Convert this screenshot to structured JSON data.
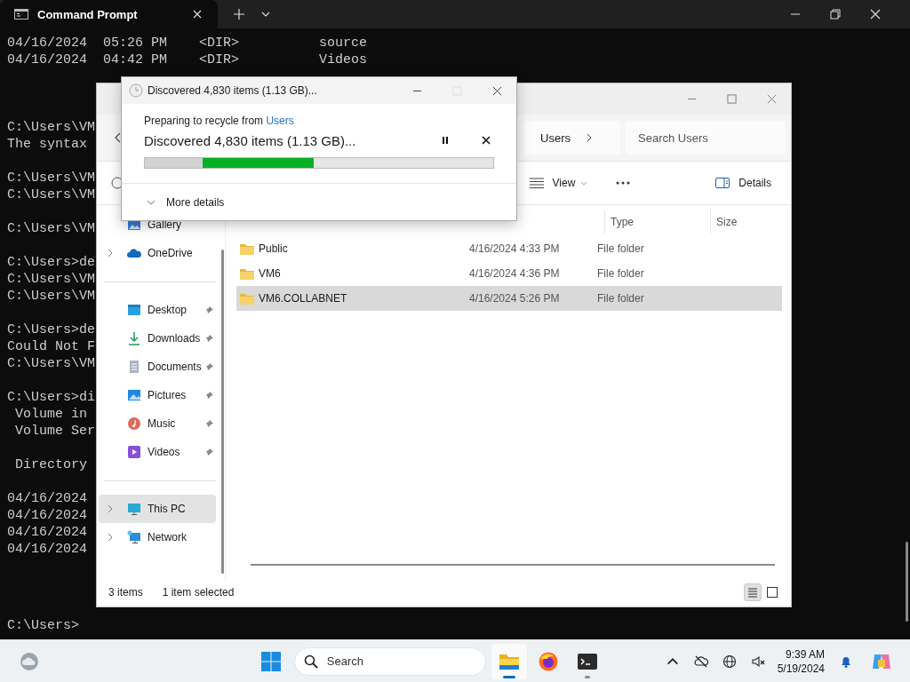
{
  "terminal": {
    "tab": {
      "title": "Command Prompt",
      "selected": true
    },
    "blocks": [
      [
        "04/16/2024  05:26 PM    <DIR>          source",
        "04/16/2024  04:42 PM    <DIR>          Videos"
      ],
      [
        "C:\\Users\\VM",
        "The syntax"
      ],
      [
        "C:\\Users\\VM",
        "C:\\Users\\VM"
      ],
      [
        "C:\\Users\\VM"
      ],
      [
        "C:\\Users>de",
        "C:\\Users\\VM",
        "C:\\Users\\VM"
      ],
      [
        "C:\\Users>de",
        "Could Not F",
        "C:\\Users\\VM"
      ],
      [
        "C:\\Users>di",
        " Volume in",
        " Volume Ser"
      ],
      [
        " Directory"
      ],
      [
        "04/16/2024",
        "04/16/2024",
        "04/16/2024",
        "04/16/2024"
      ],
      [
        "C:\\Users>"
      ]
    ]
  },
  "explorer": {
    "address": {
      "crumb": "Users"
    },
    "search": {
      "placeholder": "Search Users"
    },
    "command_bar": {
      "view": "View",
      "details": "Details"
    },
    "nav": [
      [
        {
          "label": "Gallery",
          "kind": "gallery",
          "selected": false
        },
        {
          "label": "OneDrive",
          "kind": "onedrive",
          "expanded": false,
          "selected": false
        }
      ],
      [
        {
          "label": "Desktop",
          "kind": "desktop",
          "pinned": true,
          "selected": false
        },
        {
          "label": "Downloads",
          "kind": "downloads",
          "pinned": true,
          "selected": false
        },
        {
          "label": "Documents",
          "kind": "documents",
          "pinned": true,
          "selected": false
        },
        {
          "label": "Pictures",
          "kind": "pictures",
          "pinned": true,
          "selected": false
        },
        {
          "label": "Music",
          "kind": "music",
          "pinned": true,
          "selected": false
        },
        {
          "label": "Videos",
          "kind": "videos",
          "pinned": true,
          "selected": false
        }
      ],
      [
        {
          "label": "This PC",
          "kind": "pc",
          "expanded": false,
          "selected": true
        },
        {
          "label": "Network",
          "kind": "network",
          "expanded": false,
          "selected": false
        }
      ]
    ],
    "columns": [
      "Type",
      "Size"
    ],
    "rows": [
      {
        "name": "Public",
        "date": "4/16/2024 4:33 PM",
        "type": "File folder",
        "selected": false
      },
      {
        "name": "VM6",
        "date": "4/16/2024 4:36 PM",
        "type": "File folder",
        "selected": false
      },
      {
        "name": "VM6.COLLABNET",
        "date": "4/16/2024 5:26 PM",
        "type": "File folder",
        "selected": true
      }
    ],
    "status": {
      "count": "3 items",
      "selection": "1 item selected"
    },
    "views": [
      {
        "kind": "details",
        "selected": true
      },
      {
        "kind": "tiles",
        "selected": false
      }
    ]
  },
  "dialog": {
    "title": "Discovered 4,830 items (1.13 GB)...",
    "maximize": {
      "disabled": true
    },
    "source_prefix": "Preparing to recycle from ",
    "source_link": "Users",
    "status": "Discovered 4,830 items (1.13 GB)...",
    "level": 0.485,
    "more": {
      "label": "More details",
      "expanded": false
    }
  },
  "taskbar": {
    "search": {
      "placeholder": "Search"
    },
    "apps": [
      {
        "kind": "explorer",
        "running": true,
        "active": true
      },
      {
        "kind": "firefox",
        "running": false,
        "active": false
      },
      {
        "kind": "terminal",
        "running": true,
        "active": false
      }
    ],
    "time": "9:39 AM",
    "date": "5/19/2024"
  }
}
